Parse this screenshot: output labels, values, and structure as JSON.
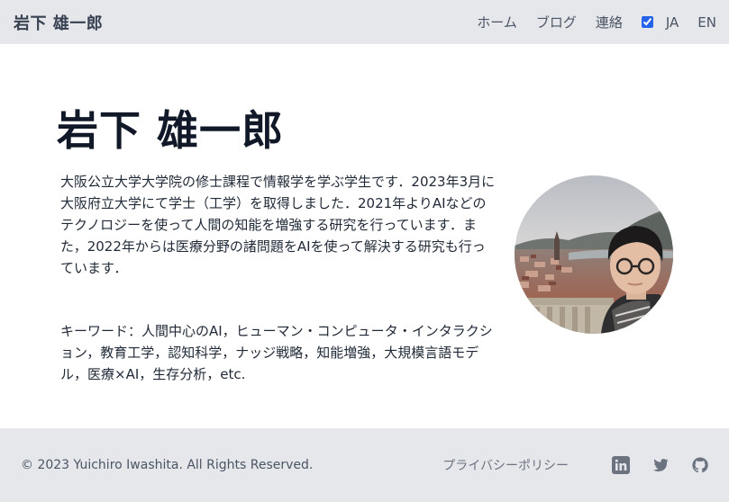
{
  "header": {
    "brand": "岩下 雄一郎",
    "nav": [
      "ホーム",
      "ブログ",
      "連絡"
    ],
    "lang_ja": "JA",
    "lang_en": "EN"
  },
  "main": {
    "title": "岩下 雄一郎",
    "bio": "大阪公立大学大学院の修士課程で情報学を学ぶ学生です．2023年3月に大阪府立大学にて学士（工学）を取得しました．2021年よりAIなどのテクノロジーを使って人間の知能を増強する研究を行っています．また，2022年からは医療分野の諸問題をAIを使って解決する研究も行っています．",
    "keywords": "キーワード：人間中心のAI，ヒューマン・コンピュータ・インタラクション，教育工学，認知科学，ナッジ戦略，知能増強，大規模言語モデル，医療×AI，生存分析，etc."
  },
  "footer": {
    "copyright": "© 2023 Yuichiro Iwashita. All Rights Reserved.",
    "privacy": "プライバシーポリシー"
  },
  "colors": {
    "header_bg": "#e5e7eb",
    "footer_bg": "#e5e7eb",
    "accent": "#2563eb"
  },
  "icons": [
    "linkedin-icon",
    "twitter-icon",
    "github-icon"
  ]
}
